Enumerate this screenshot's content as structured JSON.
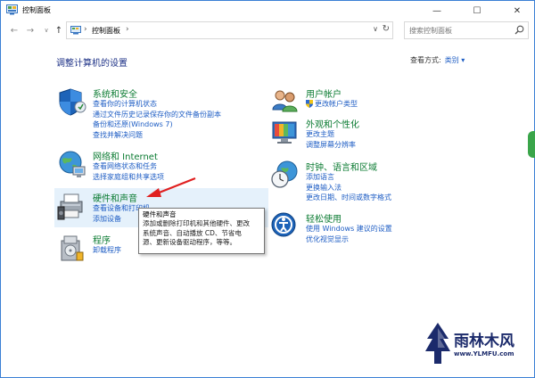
{
  "window": {
    "title": "控制面板",
    "minimize_glyph": "—",
    "maximize_glyph": "☐",
    "close_glyph": "✕"
  },
  "nav": {
    "back_glyph": "←",
    "forward_glyph": "→",
    "down_glyph": "∨",
    "up_glyph": "↑",
    "crumb_sep": "›",
    "breadcrumb": "控制面板",
    "dropdown_glyph": "∨",
    "refresh_glyph": "↻",
    "search_placeholder": "搜索控制面板"
  },
  "main": {
    "heading": "调整计算机的设置",
    "view_by_label": "查看方式:",
    "view_by_value": "类别 ▾"
  },
  "left_categories": [
    {
      "title": "系统和安全",
      "icon": "shield-icon",
      "links": [
        "查看你的计算机状态",
        "通过文件历史记录保存你的文件备份副本",
        "备份和还原(Windows 7)",
        "查找并解决问题"
      ]
    },
    {
      "title": "网络和 Internet",
      "icon": "network-globe-icon",
      "links": [
        "查看网络状态和任务",
        "选择家庭组和共享选项"
      ]
    },
    {
      "title": "硬件和声音",
      "icon": "printer-speaker-icon",
      "links": [
        "查看设备和打印机",
        "添加设备"
      ]
    },
    {
      "title": "程序",
      "icon": "programs-icon",
      "links": [
        "卸载程序"
      ]
    }
  ],
  "right_categories": [
    {
      "title": "用户帐户",
      "icon": "users-icon",
      "links": [
        "更改帐户类型"
      ]
    },
    {
      "title": "外观和个性化",
      "icon": "personalization-monitor-icon",
      "links": [
        "更改主题",
        "调整屏幕分辨率"
      ]
    },
    {
      "title": "时钟、语言和区域",
      "icon": "clock-globe-icon",
      "links": [
        "添加语言",
        "更换输入法",
        "更改日期、时间或数字格式"
      ]
    },
    {
      "title": "轻松使用",
      "icon": "ease-of-access-icon",
      "links": [
        "使用 Windows 建议的设置",
        "优化视觉显示"
      ]
    }
  ],
  "tooltip": {
    "title": "硬件和声音",
    "lines": [
      "添加或删除打印机和其他硬件、更改",
      "系统声音、自动播放 CD、节省电",
      "源、更新设备驱动程序，等等。"
    ]
  },
  "watermark": {
    "title": "雨林木风",
    "url": "www.YLMFU.com"
  },
  "colors": {
    "accent_link": "#1e5dc4",
    "category_title": "#0b7b32",
    "heading": "#1e3287",
    "arrow": "#e02020",
    "hover_bg": "#e5f1fb"
  }
}
